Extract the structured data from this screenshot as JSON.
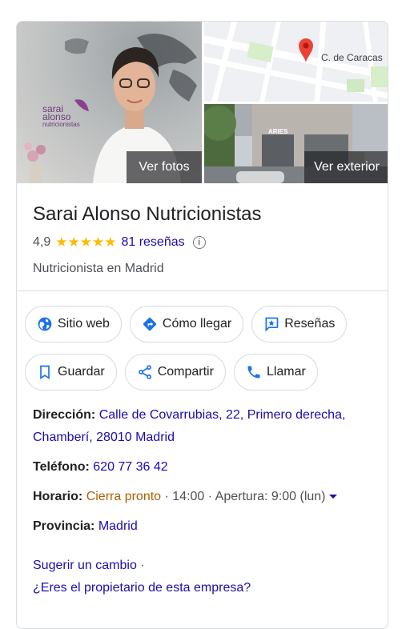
{
  "business": {
    "name": "Sarai Alonso Nutricionistas",
    "rating": "4,9",
    "stars": "★★★★★",
    "reviews_link": "81 reseñas",
    "category": "Nutricionista en Madrid"
  },
  "photos": {
    "see_photos": "Ver fotos",
    "see_exterior": "Ver exterior",
    "map_street": "C. de Caracas",
    "brand_line1": "sarai",
    "brand_line2": "alonso",
    "brand_line3": "nutricionistas",
    "storefront_sign": "ARIES"
  },
  "actions": {
    "website": "Sitio web",
    "directions": "Cómo llegar",
    "reviews": "Reseñas",
    "save": "Guardar",
    "share": "Compartir",
    "call": "Llamar"
  },
  "details": {
    "address_label": "Dirección:",
    "address_value": "Calle de Covarrubias, 22, Primero derecha, Chamberí, 28010 Madrid",
    "phone_label": "Teléfono:",
    "phone_value": "620 77 36 42",
    "hours_label": "Horario:",
    "hours_status": "Cierra pronto",
    "hours_close": " · 14:00 · ",
    "hours_open": "Apertura: 9:00 (lun)",
    "province_label": "Provincia:",
    "province_value": "Madrid"
  },
  "footer": {
    "suggest_edit": "Sugerir un cambio",
    "separator": " ·",
    "owner_question": "¿Eres el propietario de esta empresa?"
  },
  "colors": {
    "link": "#1a0dab",
    "star": "#fbbc04",
    "closing": "#b06000",
    "icon_blue": "#1a73e8",
    "map_pin": "#ea4335"
  }
}
